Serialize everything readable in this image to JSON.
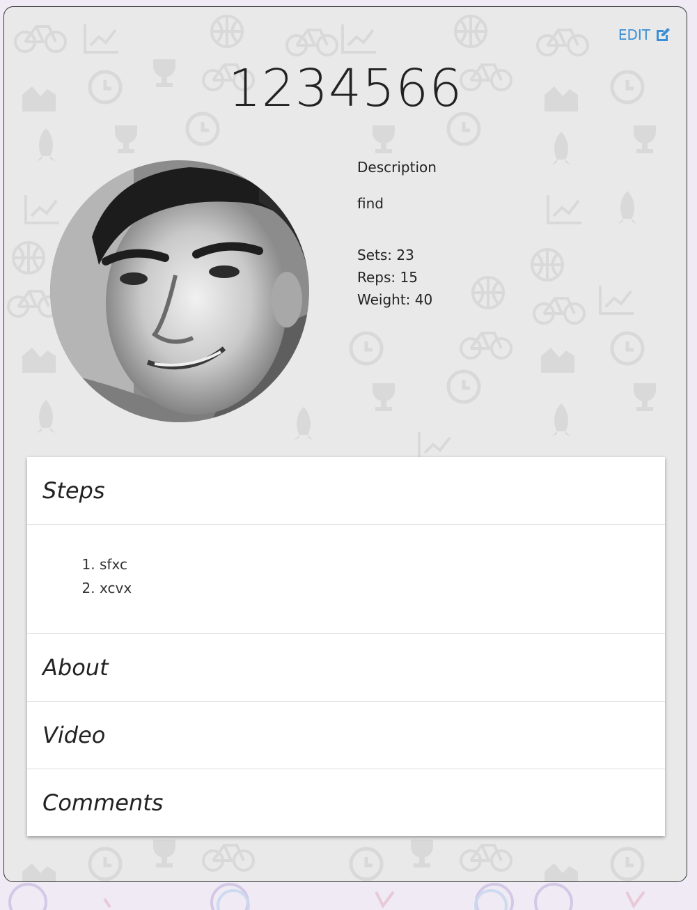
{
  "exercise": {
    "title": "1234566",
    "edit_label": "EDIT",
    "description_label": "Description",
    "description_value": "find",
    "stats": [
      {
        "text": "Sets: 23"
      },
      {
        "text": "Reps: 15"
      },
      {
        "text": "Weight: 40"
      }
    ]
  },
  "sections": {
    "steps": {
      "label": "Steps",
      "items": [
        "sfxc",
        "xcvx"
      ]
    },
    "about": {
      "label": "About"
    },
    "video": {
      "label": "Video"
    },
    "comments": {
      "label": "Comments"
    }
  },
  "colors": {
    "accent": "#3b8fd6",
    "card_background": "#e8e8e8",
    "page_background": "#efeaf4"
  },
  "icons": [
    "edit-icon",
    "avatar-photo",
    "background-pattern-icons"
  ]
}
